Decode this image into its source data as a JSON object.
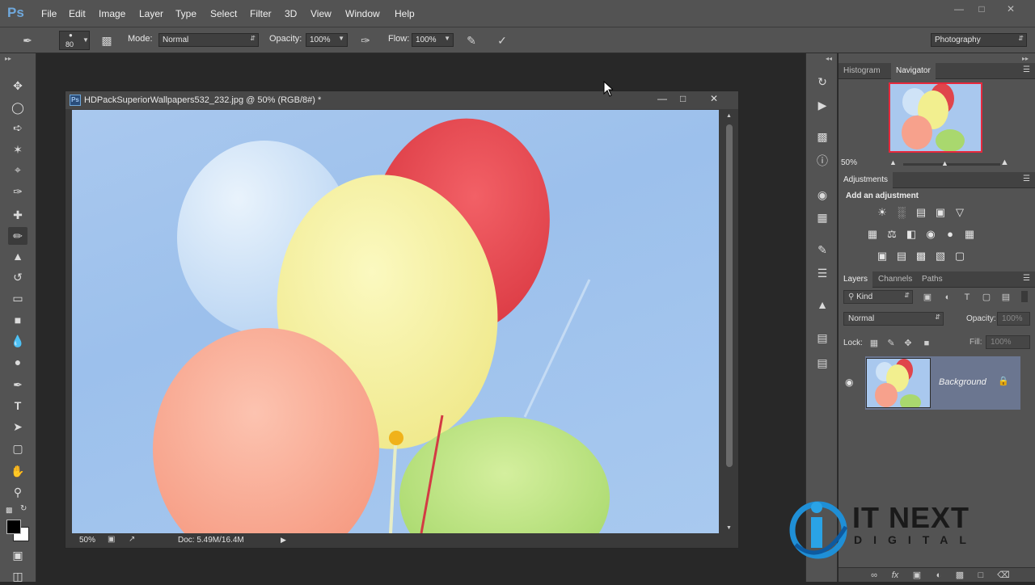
{
  "app": {
    "logo": "Ps"
  },
  "menu": [
    "File",
    "Edit",
    "Image",
    "Layer",
    "Type",
    "Select",
    "Filter",
    "3D",
    "View",
    "Window",
    "Help"
  ],
  "window_controls": [
    "minimize",
    "maximize",
    "close"
  ],
  "options": {
    "brush_size": "80",
    "mode_label": "Mode:",
    "mode_value": "Normal",
    "opacity_label": "Opacity:",
    "opacity_value": "100%",
    "flow_label": "Flow:",
    "flow_value": "100%",
    "workspace": "Photography"
  },
  "tools": [
    "move-tool",
    "marquee-tool",
    "lasso-tool",
    "magic-wand-tool",
    "crop-tool",
    "eyedropper-tool",
    "healing-brush-tool",
    "brush-tool",
    "clone-stamp-tool",
    "history-brush-tool",
    "eraser-tool",
    "gradient-tool",
    "blur-tool",
    "dodge-tool",
    "pen-tool",
    "type-tool",
    "path-selection-tool",
    "rectangle-tool",
    "hand-tool",
    "zoom-tool"
  ],
  "document": {
    "title": "HDPackSuperiorWallpapers532_232.jpg @ 50% (RGB/8#) *",
    "zoom": "50%",
    "doc_size": "Doc: 5.49M/16.4M"
  },
  "navigator": {
    "tabs": [
      "Histogram",
      "Navigator"
    ],
    "active_tab": "Navigator",
    "zoom": "50%"
  },
  "adjustments": {
    "tab": "Adjustments",
    "heading": "Add an adjustment"
  },
  "layers": {
    "tabs": [
      "Layers",
      "Channels",
      "Paths"
    ],
    "active_tab": "Layers",
    "filter": "Kind",
    "blend_mode": "Normal",
    "opacity_label": "Opacity:",
    "opacity_value": "100%",
    "lock_label": "Lock:",
    "fill_label": "Fill:",
    "fill_value": "100%",
    "layer_name": "Background"
  },
  "watermark": {
    "line1": "IT NEXT",
    "line2": "DIGITAL"
  },
  "colors": {
    "ui_dark": "#282828",
    "ui_panel": "#535353",
    "selection": "#6b7690",
    "sky": "#a9c8ee",
    "balloon_red": "#e0454b",
    "balloon_yellow": "#f2ef8f",
    "balloon_salmon": "#f7a18c",
    "balloon_green": "#a9d86e",
    "balloon_blue": "#cfe3f7"
  }
}
